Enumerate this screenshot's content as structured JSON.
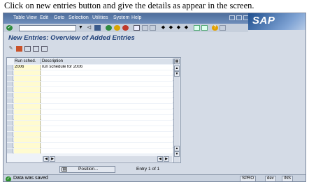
{
  "caption": "Click on new entries button and give the details as appear in the screen.",
  "menu": [
    "Table View",
    "Edit",
    "Goto",
    "Selection",
    "Utilities",
    "System",
    "Help"
  ],
  "logo": "SAP",
  "page_title": "New Entries: Overview of Added Entries",
  "table": {
    "headers": [
      "Run sched.",
      "Description"
    ],
    "rows": [
      {
        "run_sched": "2006",
        "description": "run schedule for 2006"
      }
    ]
  },
  "position_button": "Position...",
  "entry_info": "Entry 1 of 1",
  "status": {
    "message": "Data was saved",
    "transaction": "SPRO",
    "server": "dev",
    "mode": "INS"
  },
  "colors": {
    "menubar": "#4f6e9c",
    "title": "#1e3f78",
    "input_cell": "#fffbd0",
    "status_ok": "#2d8f2d"
  }
}
